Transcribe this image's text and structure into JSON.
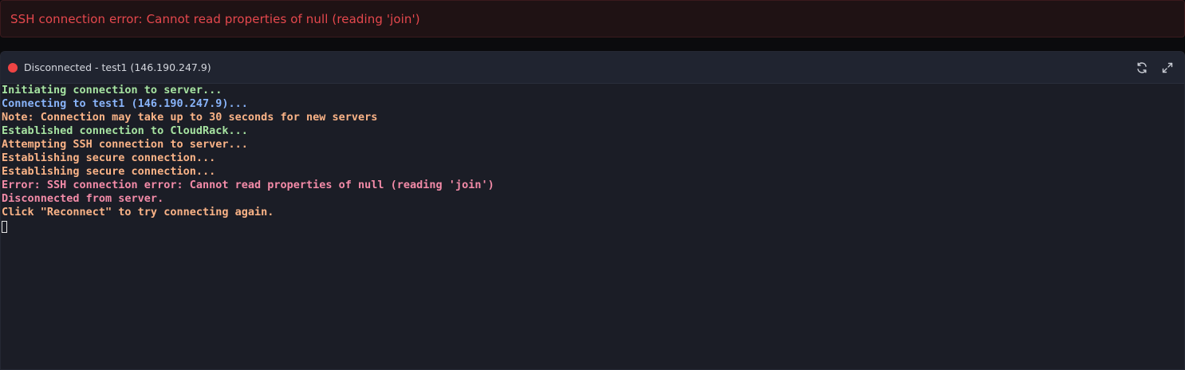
{
  "error_banner": {
    "message": "SSH connection error: Cannot read properties of null (reading 'join')",
    "color": "#e5484d"
  },
  "terminal": {
    "status": {
      "state": "disconnected",
      "indicator_color": "#ef4444",
      "text": "Disconnected - test1 (146.190.247.9)"
    },
    "actions": [
      {
        "icon": "refresh-icon",
        "name": "reconnect-button"
      },
      {
        "icon": "expand-icon",
        "name": "fullscreen-button"
      }
    ],
    "lines": [
      {
        "text": "Initiating connection to server...",
        "color": "#a6e3a1"
      },
      {
        "text": "Connecting to test1 (146.190.247.9)...",
        "color": "#89b4fa"
      },
      {
        "text": "Note: Connection may take up to 30 seconds for new servers",
        "color": "#fab387"
      },
      {
        "text": "Established connection to CloudRack...",
        "color": "#a6e3a1"
      },
      {
        "text": "Attempting SSH connection to server...",
        "color": "#fab387"
      },
      {
        "text": "Establishing secure connection...",
        "color": "#fab387"
      },
      {
        "text": "Establishing secure connection...",
        "color": "#fab387"
      },
      {
        "text": "Error: SSH connection error: Cannot read properties of null (reading 'join')",
        "color": "#f38ba8"
      },
      {
        "text": "Disconnected from server.",
        "color": "#f38ba8"
      },
      {
        "text": "Click \"Reconnect\" to try connecting again.",
        "color": "#fab387"
      }
    ]
  }
}
